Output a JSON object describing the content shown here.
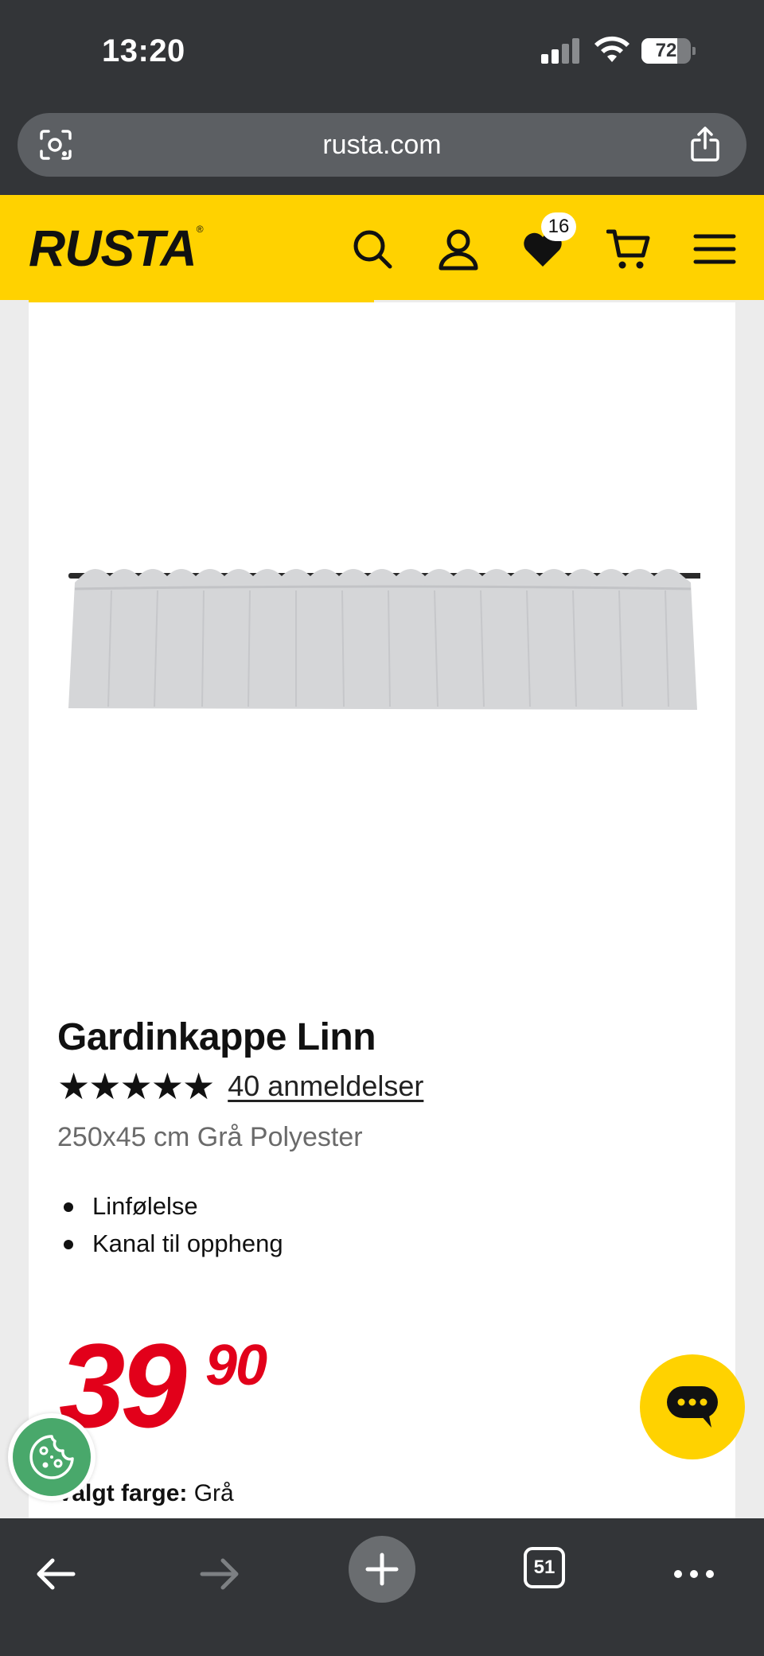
{
  "status_bar": {
    "time": "13:20",
    "battery": "72",
    "battery_level": 0.72
  },
  "browser": {
    "url": "rusta.com",
    "tabs_count": "51"
  },
  "site": {
    "logo": "RUSTA",
    "logo_mark": "®",
    "favorites_count": "16"
  },
  "product": {
    "title": "Gardinkappe Linn",
    "rating_stars": "★★★★★",
    "rating": 5,
    "reviews_text": "40 anmeldelser",
    "subtitle": "250x45 cm Grå Polyester",
    "features": [
      "Linfølelse",
      "Kanal til oppheng"
    ],
    "price_main": "39",
    "price_decimals": "90",
    "color_label": "Valgt farge:",
    "color_value": "Grå"
  },
  "colors": {
    "brand_yellow": "#ffd200",
    "price_red": "#e2001a",
    "chrome_dark": "#333538",
    "cookie_green": "#49a86b"
  }
}
